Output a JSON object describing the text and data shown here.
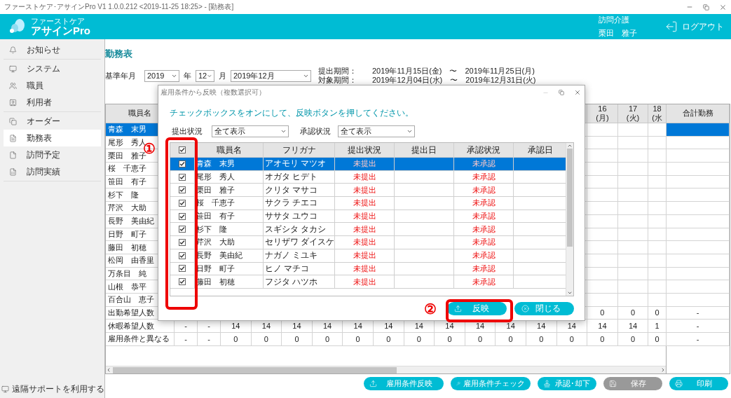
{
  "window": {
    "title": "ファーストケア･アサインPro V1 1.0.0.212 <2019-11-25 18:25> - [勤務表]"
  },
  "header": {
    "brand_sub": "ファーストケア",
    "brand": "アサインPro",
    "service": "訪問介護",
    "user": "栗田　雅子",
    "logout": "ログアウト"
  },
  "sidebar": {
    "sections": [
      {
        "items": [
          {
            "label": "お知らせ",
            "selected": false
          }
        ]
      },
      {
        "items": [
          {
            "label": "システム",
            "selected": false
          },
          {
            "label": "職員",
            "selected": false
          },
          {
            "label": "利用者",
            "selected": false
          }
        ]
      },
      {
        "items": [
          {
            "label": "オーダー",
            "selected": false
          },
          {
            "label": "勤務表",
            "selected": true
          },
          {
            "label": "訪問予定",
            "selected": false
          },
          {
            "label": "訪問実績",
            "selected": false
          }
        ]
      }
    ],
    "footer": "遠隔サポートを利用する"
  },
  "page": {
    "title": "勤務表",
    "base_label": "基準年月",
    "year": "2019",
    "year_unit": "年",
    "month": "12",
    "month_unit": "月",
    "period": "2019年12月",
    "periods": [
      {
        "label": "提出期間：",
        "range": "2019年11月15日(金)　〜　2019年11月25日(月)"
      },
      {
        "label": "対象期間：",
        "range": "2019年12月04日(水)　〜　2019年12月31日(火)"
      }
    ]
  },
  "grid": {
    "name_header": "職員名",
    "day_headers": [
      {
        "day": "16",
        "weekday": "(月)"
      },
      {
        "day": "17",
        "weekday": "(火)"
      },
      {
        "day": "18",
        "weekday": "(水"
      }
    ],
    "total_header": "合計勤務",
    "staff": [
      {
        "name": "青森　末男",
        "selected": true
      },
      {
        "name": "尾形　秀人",
        "selected": false
      },
      {
        "name": "栗田　雅子",
        "selected": false
      },
      {
        "name": "桜　千恵子",
        "selected": false
      },
      {
        "name": "笹田　有子",
        "selected": false
      },
      {
        "name": "杉下　隆",
        "selected": false
      },
      {
        "name": "芹沢　大助",
        "selected": false
      },
      {
        "name": "長野　美由紀",
        "selected": false
      },
      {
        "name": "日野　町子",
        "selected": false
      },
      {
        "name": "藤田　初穂",
        "selected": false
      },
      {
        "name": "松岡　由香里",
        "selected": false
      },
      {
        "name": "万条目　純",
        "selected": false
      },
      {
        "name": "山根　恭平",
        "selected": false
      },
      {
        "name": "百合山　恵子",
        "selected": false
      }
    ],
    "summary_rows": [
      {
        "label": "出勤希望人数",
        "cells": [
          "0",
          "0",
          "0"
        ],
        "total": "-"
      },
      {
        "label": "休暇希望人数",
        "cells": [
          "-",
          "-",
          "14",
          "14",
          "14",
          "14",
          "14",
          "14",
          "14",
          "14",
          "14",
          "14",
          "14",
          "14",
          "14",
          "14",
          "1"
        ],
        "total": "-"
      },
      {
        "label": "雇用条件と異なる",
        "cells": [
          "-",
          "-",
          "0",
          "0",
          "0",
          "0",
          "0",
          "0",
          "0",
          "0",
          "0",
          "0",
          "0",
          "0",
          "0",
          "0",
          "0"
        ],
        "total": "-"
      }
    ]
  },
  "dialog": {
    "title": "雇用条件から反映（複数選択可）",
    "instruction": "チェックボックスをオンにして、反映ボタンを押してください。",
    "filters": [
      {
        "label": "提出状況",
        "value": "全て表示"
      },
      {
        "label": "承認状況",
        "value": "全て表示"
      }
    ],
    "all_checked": true,
    "columns": [
      "職員名",
      "フリガナ",
      "提出状況",
      "提出日",
      "承認状況",
      "承認日"
    ],
    "rows": [
      {
        "checked": true,
        "selected": true,
        "name": "青森　末男",
        "kana": "アオモリ マツオ",
        "submit_status": "未提出",
        "approval_status": "未承認"
      },
      {
        "checked": true,
        "selected": false,
        "name": "尾形　秀人",
        "kana": "オガタ ヒデト",
        "submit_status": "未提出",
        "approval_status": "未承認"
      },
      {
        "checked": true,
        "selected": false,
        "name": "栗田　雅子",
        "kana": "クリタ マサコ",
        "submit_status": "未提出",
        "approval_status": "未承認"
      },
      {
        "checked": true,
        "selected": false,
        "name": "桜　千恵子",
        "kana": "サクラ チエコ",
        "submit_status": "未提出",
        "approval_status": "未承認"
      },
      {
        "checked": true,
        "selected": false,
        "name": "笹田　有子",
        "kana": "ササタ ユウコ",
        "submit_status": "未提出",
        "approval_status": "未承認"
      },
      {
        "checked": true,
        "selected": false,
        "name": "杉下　隆",
        "kana": "スギシタ タカシ",
        "submit_status": "未提出",
        "approval_status": "未承認"
      },
      {
        "checked": true,
        "selected": false,
        "name": "芹沢　大助",
        "kana": "セリザワ ダイスケ",
        "submit_status": "未提出",
        "approval_status": "未承認"
      },
      {
        "checked": true,
        "selected": false,
        "name": "長野　美由紀",
        "kana": "ナガノ ミユキ",
        "submit_status": "未提出",
        "approval_status": "未承認"
      },
      {
        "checked": true,
        "selected": false,
        "name": "日野　町子",
        "kana": "ヒノ マチコ",
        "submit_status": "未提出",
        "approval_status": "未承認"
      },
      {
        "checked": true,
        "selected": false,
        "name": "藤田　初穂",
        "kana": "フジタ ハツホ",
        "submit_status": "未提出",
        "approval_status": "未承認"
      }
    ],
    "buttons": [
      {
        "label": "反映"
      },
      {
        "label": "閉じる"
      }
    ]
  },
  "annotations": [
    {
      "label": "①"
    },
    {
      "label": "②"
    }
  ],
  "actions": [
    {
      "label": "雇用条件反映",
      "disabled": false
    },
    {
      "label": "雇用条件チェック",
      "disabled": false
    },
    {
      "label": "承認･却下",
      "disabled": false
    },
    {
      "label": "保存",
      "disabled": true
    },
    {
      "label": "印刷",
      "disabled": false
    }
  ]
}
